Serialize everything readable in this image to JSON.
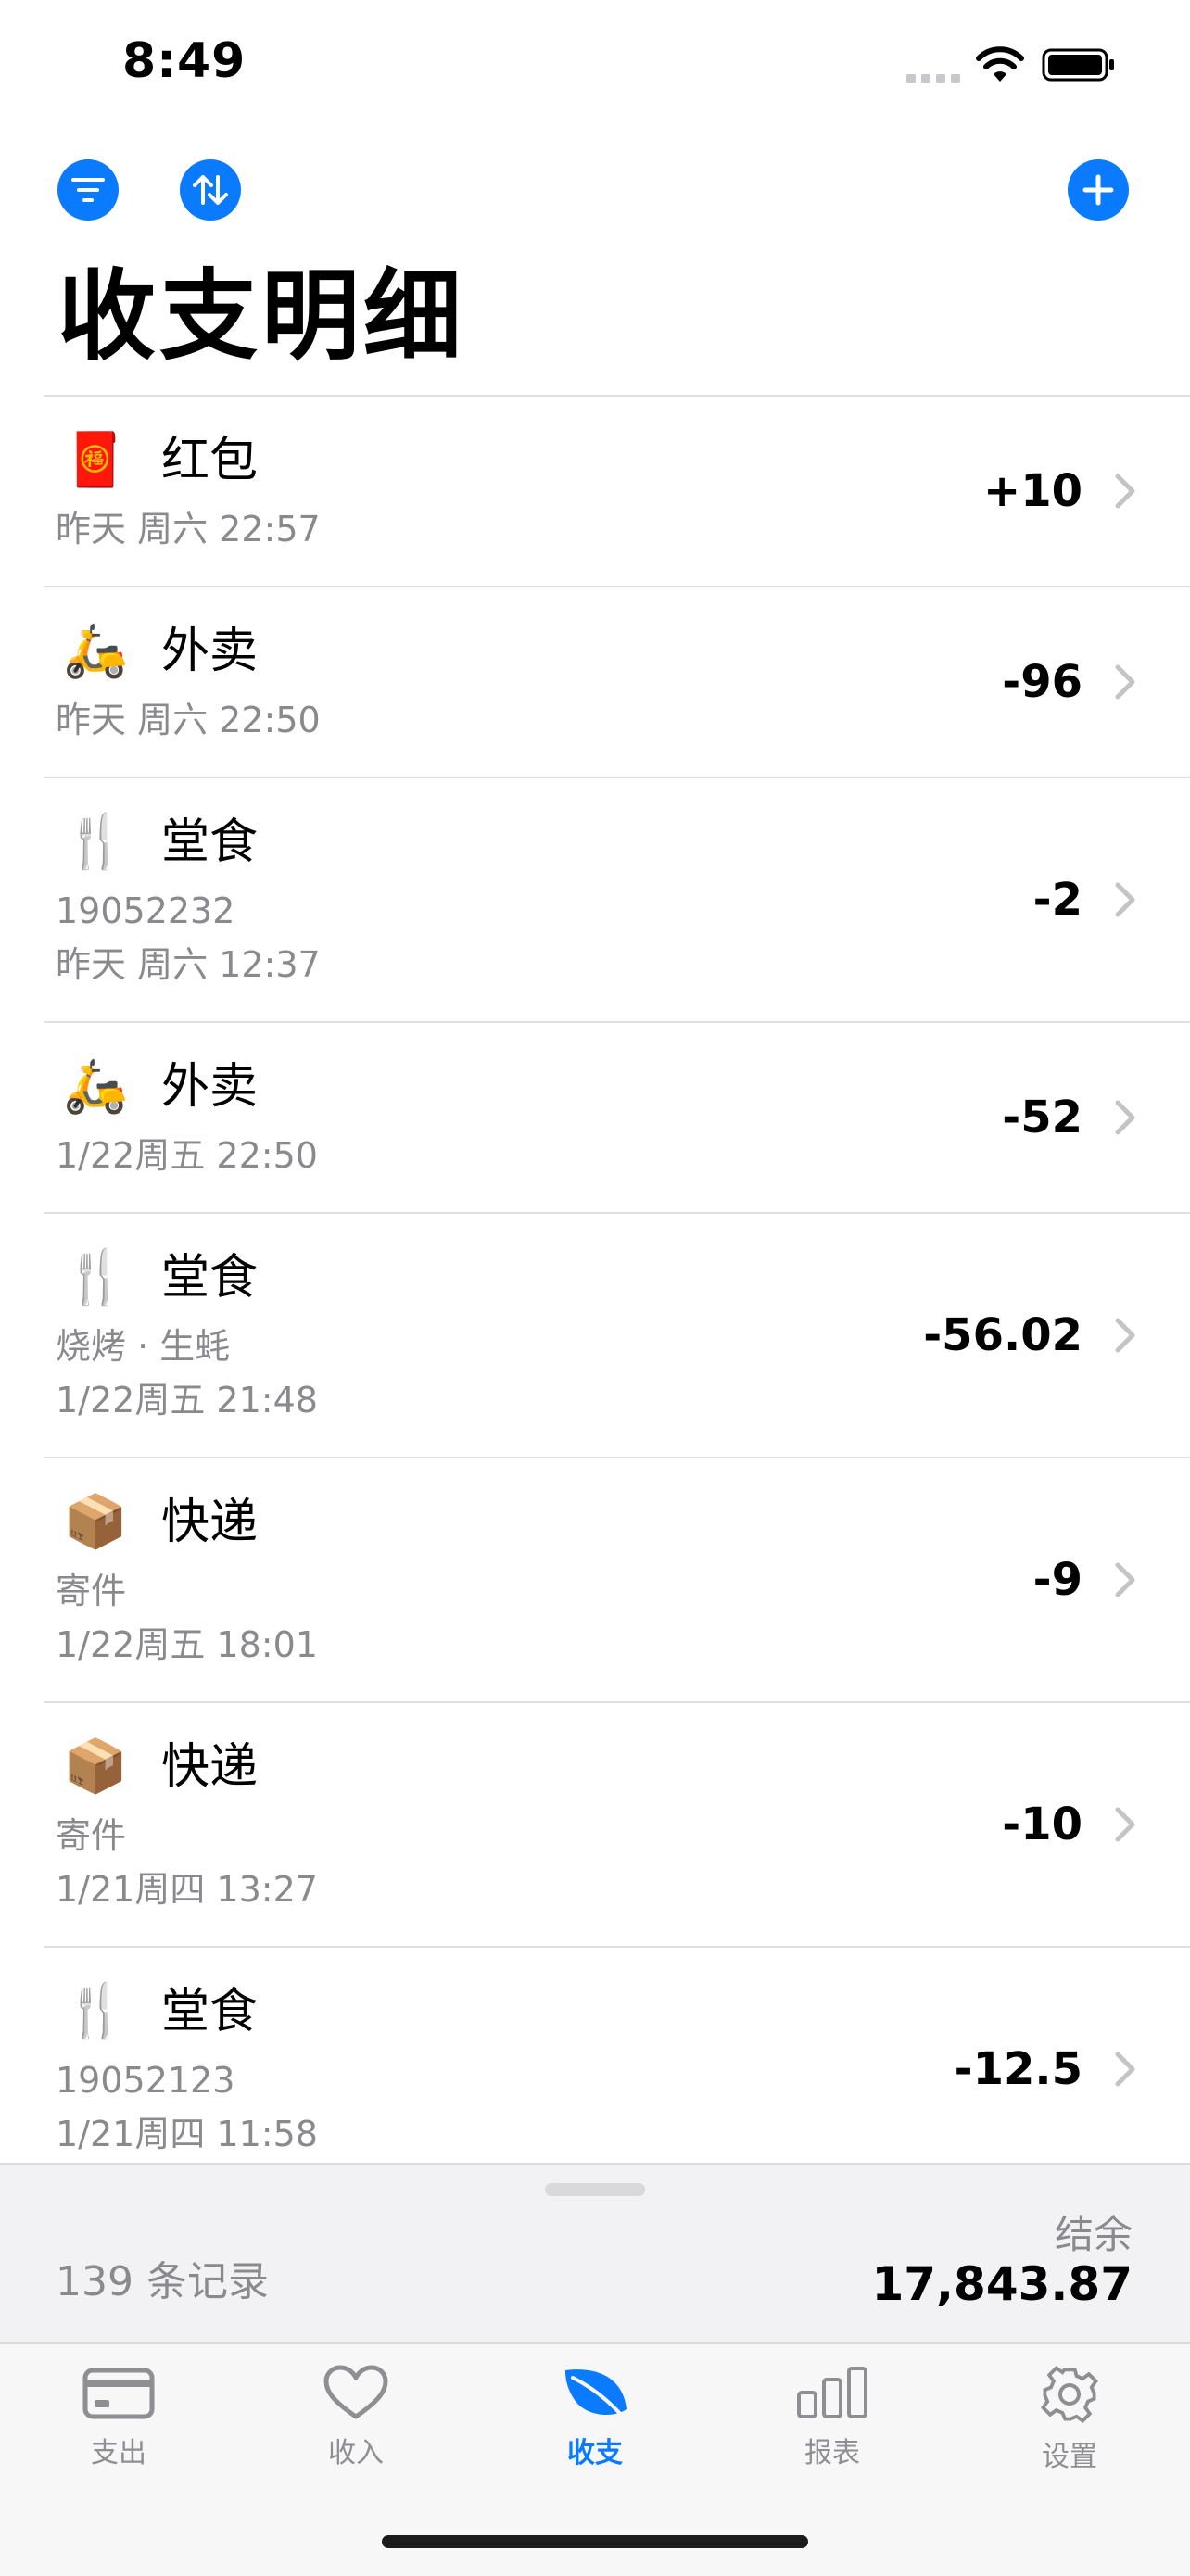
{
  "status": {
    "time": "8:49"
  },
  "header": {
    "title": "收支明细",
    "filter_icon": "filter-icon",
    "sort_icon": "sort-icon",
    "add_icon": "plus-icon",
    "accent": "#0a7aff"
  },
  "transactions": [
    {
      "emoji": "🧧",
      "category": "红包",
      "lines": [
        "昨天 周六 22:57"
      ],
      "amount": "+10"
    },
    {
      "emoji": "🛵",
      "category": "外卖",
      "lines": [
        "昨天 周六 22:50"
      ],
      "amount": "-96"
    },
    {
      "emoji": "🍴",
      "category": "堂食",
      "lines": [
        "19052232",
        "昨天 周六 12:37"
      ],
      "amount": "-2"
    },
    {
      "emoji": "🛵",
      "category": "外卖",
      "lines": [
        "1/22周五 22:50"
      ],
      "amount": "-52"
    },
    {
      "emoji": "🍴",
      "category": "堂食",
      "lines": [
        "烧烤 · 生蚝",
        "1/22周五 21:48"
      ],
      "amount": "-56.02"
    },
    {
      "emoji": "📦",
      "category": "快递",
      "lines": [
        "寄件",
        "1/22周五 18:01"
      ],
      "amount": "-9"
    },
    {
      "emoji": "📦",
      "category": "快递",
      "lines": [
        "寄件",
        "1/21周四 13:27"
      ],
      "amount": "-10"
    },
    {
      "emoji": "🍴",
      "category": "堂食",
      "lines": [
        "19052123",
        "1/21周四 11:58"
      ],
      "amount": "-12.5"
    }
  ],
  "summary": {
    "count": "139 条记录",
    "balance_label": "结余",
    "balance": "17,843.87"
  },
  "tabs": [
    {
      "label": "支出",
      "icon": "card-icon",
      "active": false
    },
    {
      "label": "收入",
      "icon": "heart-icon",
      "active": false
    },
    {
      "label": "收支",
      "icon": "leaf-icon",
      "active": true
    },
    {
      "label": "报表",
      "icon": "bar-chart-icon",
      "active": false
    },
    {
      "label": "设置",
      "icon": "gear-icon",
      "active": false
    }
  ]
}
